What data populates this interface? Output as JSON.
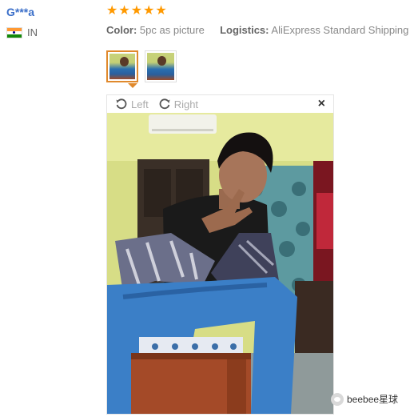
{
  "review": {
    "user_name": "G***a",
    "country_code": "IN",
    "rating": 5,
    "color_label": "Color:",
    "color_value": "5pc as picture",
    "logistics_label": "Logistics:",
    "logistics_value": "AliExpress Standard Shipping"
  },
  "viewer": {
    "left_label": "Left",
    "right_label": "Right",
    "close_symbol": "×"
  },
  "watermark": {
    "text": "beebee星球"
  },
  "colors": {
    "user_name": "#3b6fc9",
    "star": "#ff9900",
    "active_thumb_border": "#e0892c"
  },
  "icons": [
    "india-flag-icon",
    "star-icon",
    "rotate-left-icon",
    "rotate-right-icon",
    "close-icon",
    "wechat-icon"
  ]
}
